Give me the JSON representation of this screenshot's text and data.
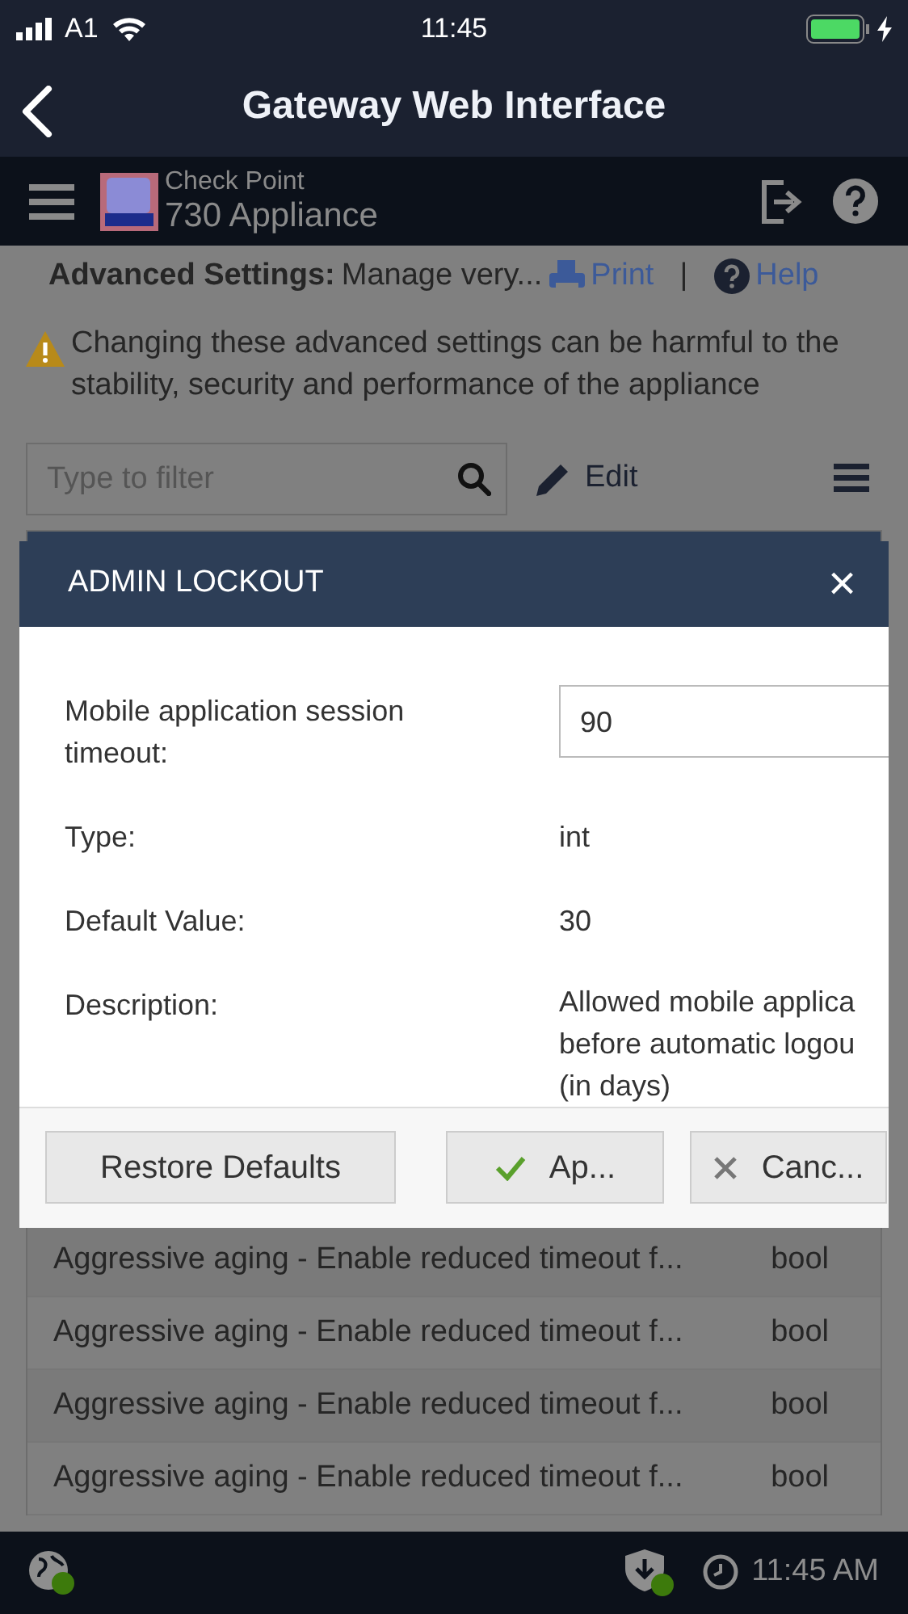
{
  "status_bar": {
    "carrier": "A1",
    "time": "11:45"
  },
  "nav_bar": {
    "title": "Gateway Web Interface"
  },
  "app_header": {
    "vendor": "Check Point",
    "product": "730 Appliance"
  },
  "page_header": {
    "title": "Advanced Settings:",
    "subtitle": "Manage very...",
    "links": [
      "Print",
      "Help"
    ],
    "separator": "|"
  },
  "warning": "Changing these advanced settings can be harmful to the stability, security and performance of the appliance",
  "toolbar": {
    "filter": {
      "placeholder": "Type to filter"
    },
    "edit": "Edit"
  },
  "table": {
    "rows": [
      {
        "name": "Aggressive aging - Enable reduced timeout f...",
        "type": "bool"
      },
      {
        "name": "Aggressive aging - Enable reduced timeout f...",
        "type": "bool"
      },
      {
        "name": "Aggressive aging - Enable reduced timeout f...",
        "type": "bool"
      },
      {
        "name": "Aggressive aging - Enable reduced timeout f...",
        "type": "bool"
      }
    ]
  },
  "modal": {
    "title": "ADMIN LOCKOUT",
    "close": "×",
    "fields": [
      {
        "kind": "input",
        "label": "Mobile application session timeout:",
        "value": "90"
      },
      {
        "kind": "text",
        "label": "Type:",
        "value": "int"
      },
      {
        "kind": "text",
        "label": "Default Value:",
        "value": "30"
      },
      {
        "kind": "multiline",
        "label": "Description:",
        "lines": [
          "Allowed mobile applica",
          "before automatic logou",
          "(in days)"
        ]
      }
    ],
    "buttons": [
      {
        "kind": "restore",
        "label": "Restore Defaults"
      },
      {
        "kind": "apply",
        "label": "Ap..."
      },
      {
        "kind": "cancel",
        "label": "Canc..."
      }
    ]
  },
  "footer": {
    "time": "11:45 AM"
  }
}
